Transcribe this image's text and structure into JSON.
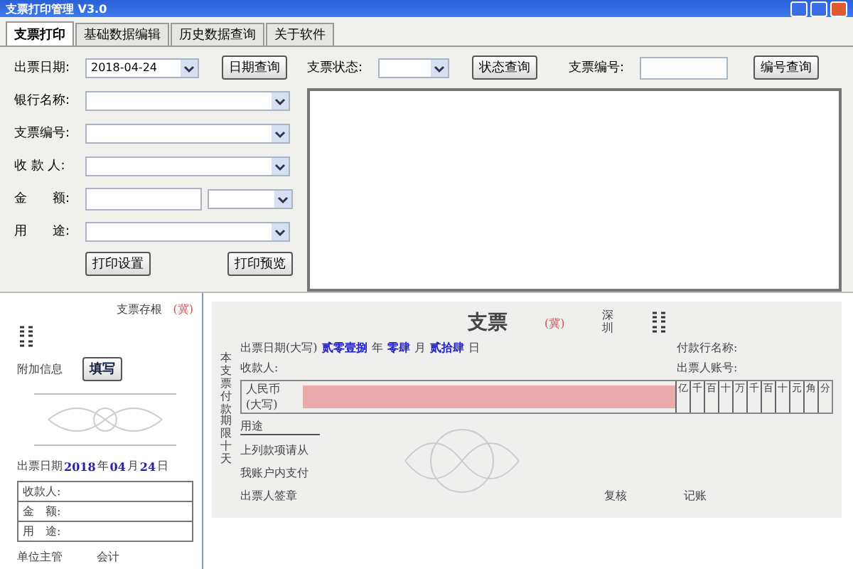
{
  "window": {
    "title": "支票打印管理 V3.0"
  },
  "tabs": [
    {
      "label": "支票打印",
      "selected": true
    },
    {
      "label": "基础数据编辑",
      "selected": false
    },
    {
      "label": "历史数据查询",
      "selected": false
    },
    {
      "label": "关于软件",
      "selected": false
    }
  ],
  "query": {
    "date_label": "出票日期:",
    "date_value": "2018-04-24",
    "date_button": "日期查询",
    "status_label": "支票状态:",
    "status_button": "状态查询",
    "number_label": "支票编号:",
    "number_button": "编号查询"
  },
  "fields": [
    {
      "label": "银行名称:",
      "kind": "select"
    },
    {
      "label": "支票编号:",
      "kind": "select"
    },
    {
      "label": "收 款 人:",
      "kind": "select"
    },
    {
      "label": "金　　额:",
      "kind": "split"
    },
    {
      "label": "用　　途:",
      "kind": "select"
    }
  ],
  "buttons": [
    "打印设置",
    "打印预览"
  ],
  "stub": {
    "title": "支票存根",
    "region": "(冀)",
    "extra_label": "附加信息",
    "extra_button": "填写",
    "date_label": "出票日期",
    "year": "2018",
    "year_unit": "年",
    "month": "04",
    "month_unit": "月",
    "day": "24",
    "day_unit": "日",
    "rows": [
      "收款人:",
      "金　额:",
      "用　途:"
    ],
    "signers": [
      "单位主管",
      "会计"
    ]
  },
  "cheque": {
    "title": "支票",
    "region": "(冀)",
    "city": "深圳",
    "side_note": "本支票付款期限十天",
    "date_label": "出票日期(大写)",
    "year": "贰零壹捌",
    "year_unit": "年",
    "month": "零肆",
    "month_unit": "月",
    "day": "贰拾肆",
    "day_unit": "日",
    "bank_label": "付款行名称:",
    "payee_label": "收款人:",
    "account_label": "出票人账号:",
    "currency": "人民币",
    "currency_note": "(大写)",
    "digits": [
      "亿",
      "千",
      "百",
      "十",
      "万",
      "千",
      "百",
      "十",
      "元",
      "角",
      "分"
    ],
    "purpose_label": "用途",
    "lines": [
      "上列款项请从",
      "我账户内支付",
      "出票人签章"
    ],
    "signers": [
      "复核",
      "记账"
    ]
  }
}
